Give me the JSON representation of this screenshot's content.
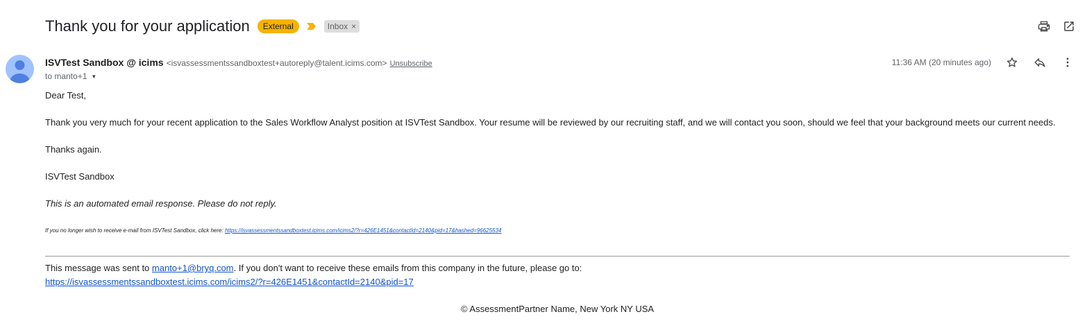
{
  "header": {
    "subject": "Thank you for your application",
    "labels": {
      "external": "External",
      "inbox": "Inbox",
      "inbox_remove": "×"
    },
    "colors": {
      "external_bg": "#f6b400",
      "importance": "#f6b400"
    },
    "icons": [
      "printer-icon",
      "open-in-new-window-icon"
    ]
  },
  "message": {
    "sender_name": "ISVTest Sandbox @ icims",
    "sender_email": "<isvassessmentssandboxtest+autoreply@talent.icims.com>",
    "unsubscribe": "Unsubscribe",
    "to": "to manto+1",
    "timestamp": "11:36 AM (20 minutes ago)",
    "icons": [
      "star-icon",
      "reply-icon",
      "more-vert-icon"
    ]
  },
  "body": {
    "greeting": "Dear Test,",
    "main": "Thank you very much for your recent application to the Sales Workflow Analyst position at ISVTest Sandbox. Your resume will be reviewed by our recruiting staff, and we will contact you soon, should we feel that your background meets our current needs.",
    "thanks": "Thanks again.",
    "signature": "ISVTest Sandbox",
    "auto_notice": "This is an automated email response. Please do not reply.",
    "optout_text": "If you no longer wish to receive e-mail from ISVTest Sandbox, click here: ",
    "optout_link": "https://isvassessmentssandboxtest.icims.com/icims2/?r=426E1451&contactId=2140&pid=17&hashed=96625534"
  },
  "footer": {
    "sent_prefix": "This message was sent to ",
    "sent_email": "manto+1@bryq.com",
    "sent_suffix": ". If you don't want to receive these emails from this company in the future, please go to:",
    "unsubscribe_link": "https://isvassessmentssandboxtest.icims.com/icims2/?r=426E1451&contactId=2140&pid=17",
    "copyright": "© AssessmentPartner Name, New York NY USA"
  }
}
